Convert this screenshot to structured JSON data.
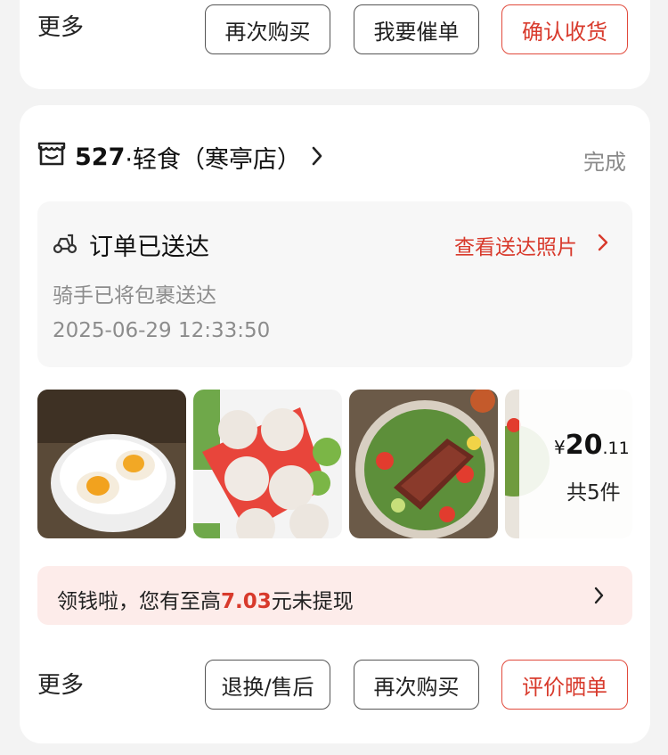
{
  "top_card": {
    "more_label": "更多",
    "buttons": [
      "再次购买",
      "我要催单",
      "确认收货"
    ]
  },
  "order": {
    "store_number": "527",
    "store_name": "·轻食（寒亭店）",
    "status": "完成",
    "delivery": {
      "title": "订单已送达",
      "view_photos_label": "查看送达照片",
      "rider_text": "骑手已将包裹送达",
      "time": "2025-06-29 12:33:50"
    },
    "products": [
      {
        "icon": "boiled-egg-image"
      },
      {
        "icon": "fish-balls-image"
      },
      {
        "icon": "steak-salad-image"
      },
      {
        "icon": "salad-image"
      }
    ],
    "price": {
      "currency": "¥",
      "integer": "20",
      "decimal": ".11"
    },
    "item_count": "共5件",
    "promo": {
      "prefix": "领钱啦，您有至高",
      "amount": "7.03",
      "suffix": "元未提现"
    },
    "more_label": "更多",
    "buttons": [
      "退换/售后",
      "再次购买",
      "评价晒单"
    ]
  },
  "colors": {
    "accent_red": "#d83a2c",
    "promo_bg": "#fdecea",
    "muted_text": "#8c8c8c"
  }
}
